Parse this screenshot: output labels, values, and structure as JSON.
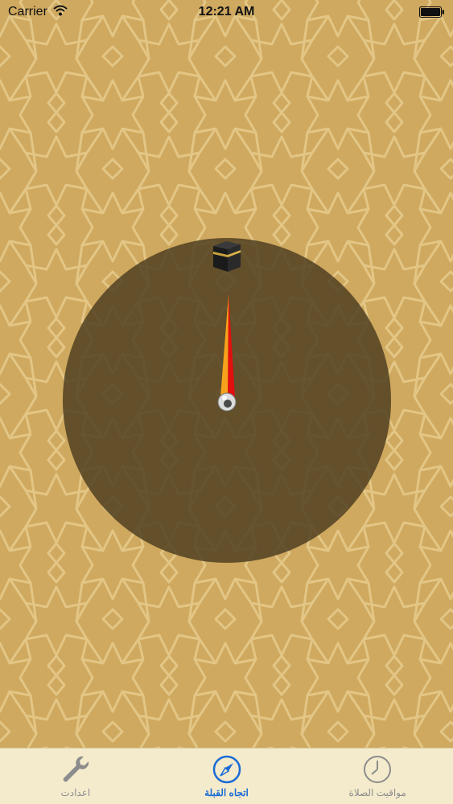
{
  "status_bar": {
    "carrier": "Carrier",
    "time": "12:21 AM"
  },
  "compass": {
    "kaaba_icon": "kaaba-icon",
    "needle_colors": [
      "#e10f0f",
      "#f6a21c"
    ]
  },
  "tabs": [
    {
      "label": "اعدادت",
      "icon": "wrench-icon",
      "active": false
    },
    {
      "label": "اتجاه القبلة",
      "icon": "compass-icon",
      "active": true
    },
    {
      "label": "مواقيت الصلاة",
      "icon": "clock-icon",
      "active": false
    }
  ],
  "colors": {
    "background": "#cfa95f",
    "pattern_line": "#e3c685",
    "compass_disc": "#5d4a2a",
    "tab_bar": "#f4ebcc",
    "active_tab": "#1a6bd6",
    "inactive_tab": "#8c8c8c"
  }
}
